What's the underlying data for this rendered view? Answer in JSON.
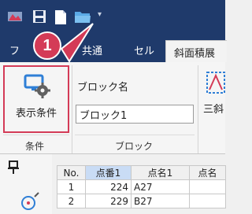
{
  "tabs": {
    "file": "フ",
    "common": "共通",
    "cell": "セル",
    "slope": "斜面積展開"
  },
  "callout": {
    "number": "1"
  },
  "ribbon": {
    "display_button_label": "表示条件",
    "block_name_label": "ブロック名",
    "block_name_value": "ブロック1",
    "slope_button_label": "三斜",
    "groups": {
      "condition": "条件",
      "block": "ブロック"
    }
  },
  "grid": {
    "columns": [
      "No.",
      "点番1",
      "点名1",
      "点名"
    ],
    "rows": [
      {
        "no": "1",
        "point_no": "224",
        "point_name": "A27",
        "extra": ""
      },
      {
        "no": "2",
        "point_no": "229",
        "point_name": "B27",
        "extra": ""
      }
    ]
  },
  "colors": {
    "titlebar": "#1f3a6b",
    "accent": "#d43b57",
    "ribbon_bg": "#f5f5f5"
  },
  "icons": [
    "app-icon",
    "save-icon",
    "new-file-icon",
    "open-folder-icon",
    "customize-toolbar-icon",
    "monitor-gear-icon",
    "pin-icon",
    "point-tool-icon"
  ]
}
